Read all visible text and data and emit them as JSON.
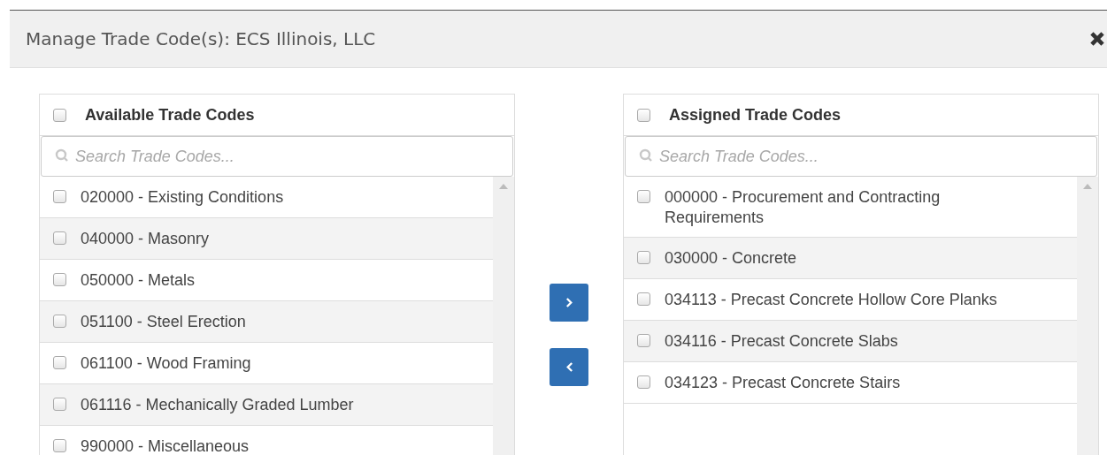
{
  "dialog": {
    "title": "Manage Trade Code(s): ECS Illinois, LLC"
  },
  "available": {
    "title": "Available Trade Codes",
    "checked": false,
    "search": {
      "placeholder": "Search Trade Codes..."
    },
    "items": [
      {
        "label": "020000 - Existing Conditions",
        "checked": false
      },
      {
        "label": "040000 - Masonry",
        "checked": false
      },
      {
        "label": "050000 - Metals",
        "checked": false
      },
      {
        "label": "051100 - Steel Erection",
        "checked": false
      },
      {
        "label": "061100 - Wood Framing",
        "checked": false
      },
      {
        "label": "061116 - Mechanically Graded Lumber",
        "checked": false
      },
      {
        "label": "990000 - Miscellaneous",
        "checked": false
      }
    ]
  },
  "assigned": {
    "title": "Assigned Trade Codes",
    "checked": false,
    "search": {
      "placeholder": "Search Trade Codes..."
    },
    "items": [
      {
        "label": "000000 - Procurement and Contracting Requirements",
        "checked": false
      },
      {
        "label": "030000 - Concrete",
        "checked": false
      },
      {
        "label": "034113 - Precast Concrete Hollow Core Planks",
        "checked": false
      },
      {
        "label": "034116 - Precast Concrete Slabs",
        "checked": false
      },
      {
        "label": "034123 - Precast Concrete Stairs",
        "checked": false
      }
    ]
  }
}
